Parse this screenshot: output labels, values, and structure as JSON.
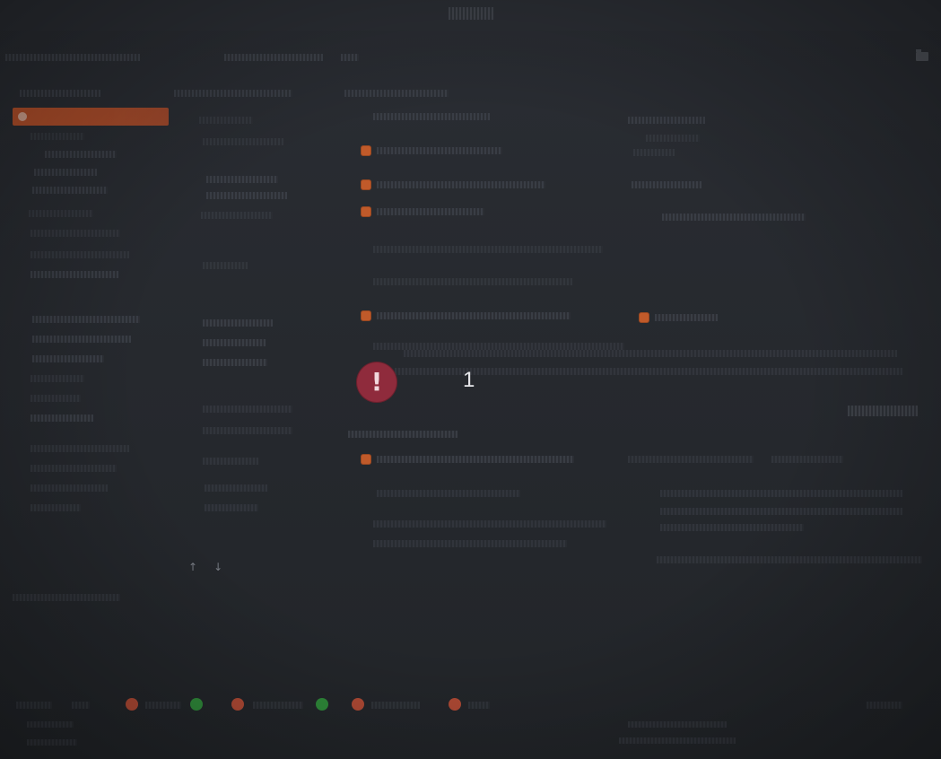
{
  "alert": {
    "icon": "exclamation-icon",
    "glyph": "!",
    "count": "1"
  },
  "scroll": {
    "up_glyph": "↑",
    "down_glyph": "↓"
  },
  "colors": {
    "background": "#24272c",
    "accent_selected": "#c0532a",
    "alert_icon_bg": "#8f2b3c",
    "status_red": "#b04a35",
    "status_green": "#2f8a3a"
  }
}
